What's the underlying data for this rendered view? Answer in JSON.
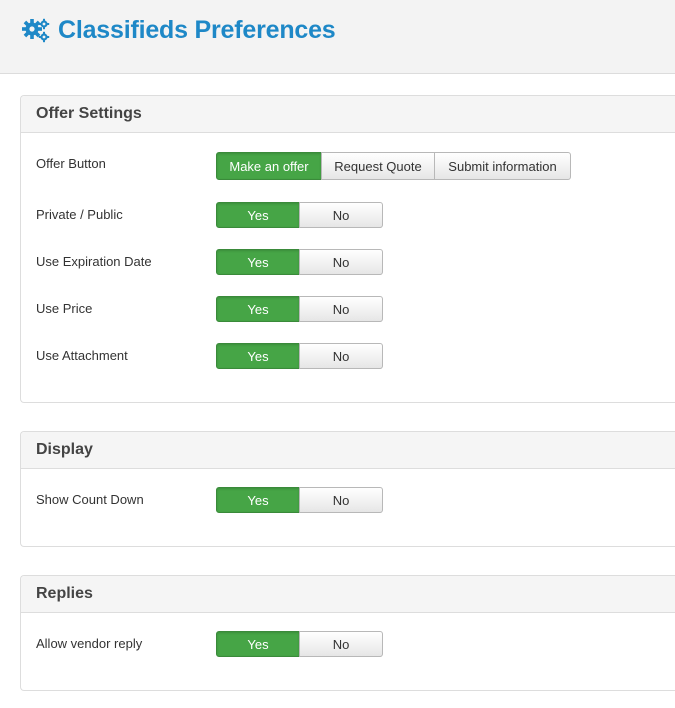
{
  "header": {
    "title": "Classifieds Preferences",
    "icon": "gears-icon",
    "title_color": "#1e88c7"
  },
  "colors": {
    "active_green": "#46a546",
    "header_bg": "#f3f3f3",
    "panel_head_bg": "#f5f5f5"
  },
  "sections": {
    "offer": {
      "title": "Offer Settings",
      "offer_button": {
        "label": "Offer Button",
        "options": [
          "Make an offer",
          "Request Quote",
          "Submit information"
        ],
        "selected": "Make an offer"
      },
      "private_public": {
        "label": "Private / Public",
        "yes": "Yes",
        "no": "No",
        "selected": "Yes"
      },
      "expiration": {
        "label": "Use Expiration Date",
        "yes": "Yes",
        "no": "No",
        "selected": "Yes"
      },
      "price": {
        "label": "Use Price",
        "yes": "Yes",
        "no": "No",
        "selected": "Yes"
      },
      "attachment": {
        "label": "Use Attachment",
        "yes": "Yes",
        "no": "No",
        "selected": "Yes"
      }
    },
    "display": {
      "title": "Display",
      "countdown": {
        "label": "Show Count Down",
        "yes": "Yes",
        "no": "No",
        "selected": "Yes"
      }
    },
    "replies": {
      "title": "Replies",
      "vendor_reply": {
        "label": "Allow vendor reply",
        "yes": "Yes",
        "no": "No",
        "selected": "Yes"
      }
    }
  }
}
